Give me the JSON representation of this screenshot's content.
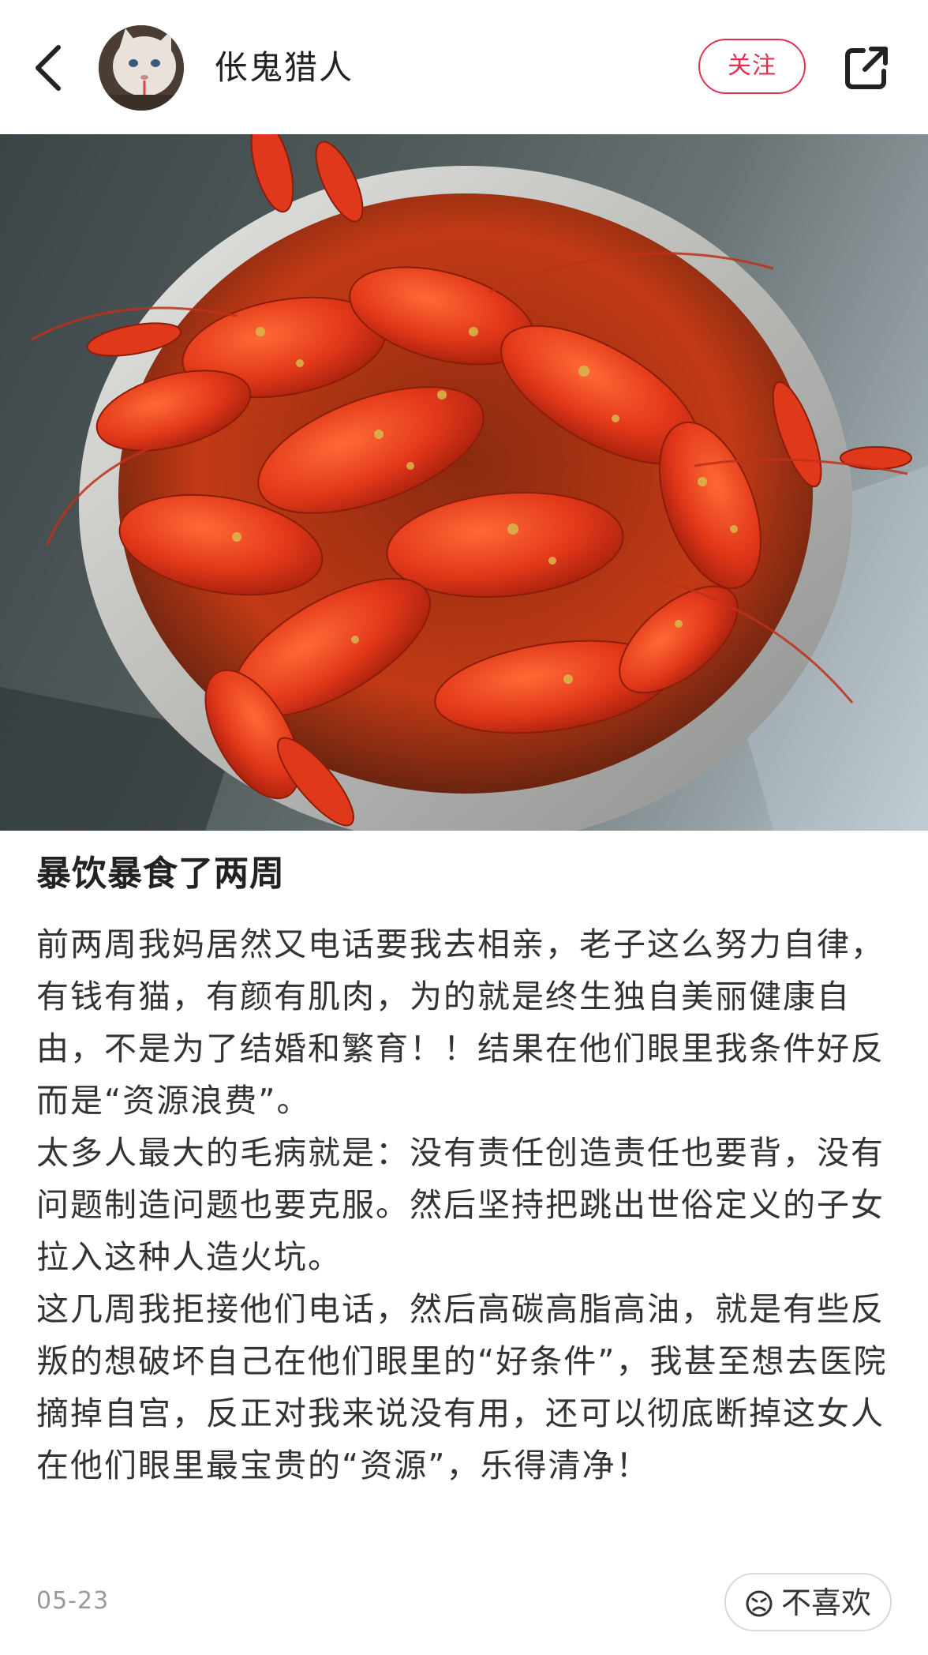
{
  "header": {
    "back_icon": "chevron-left-icon",
    "username": "伥鬼猎人",
    "follow_label": "关注",
    "share_icon": "share-external-icon",
    "accent": "#e0304f"
  },
  "post": {
    "image_subject": "crayfish-bowl-photo",
    "title": "暴饮暴食了两周",
    "paragraphs": [
      "前两周我妈居然又电话要我去相亲，老子这么努力自律，有钱有猫，有颜有肌肉，为的就是终生独自美丽健康自由，不是为了结婚和繁育！！结果在他们眼里我条件好反而是“资源浪费”。",
      "太多人最大的毛病就是：没有责任创造责任也要背，没有问题制造问题也要克服。然后坚持把跳出世俗定义的子女拉入这种人造火坑。",
      "这几周我拒接他们电话，然后高碳高脂高油，就是有些反叛的想破坏自己在他们眼里的“好条件”，我甚至想去医院摘掉自宫，反正对我来说没有用，还可以彻底断掉这女人在他们眼里最宝贵的“资源”，乐得清净！"
    ],
    "date": "05-23",
    "dislike_label": "不喜欢",
    "dislike_icon": "sad-face-icon"
  }
}
